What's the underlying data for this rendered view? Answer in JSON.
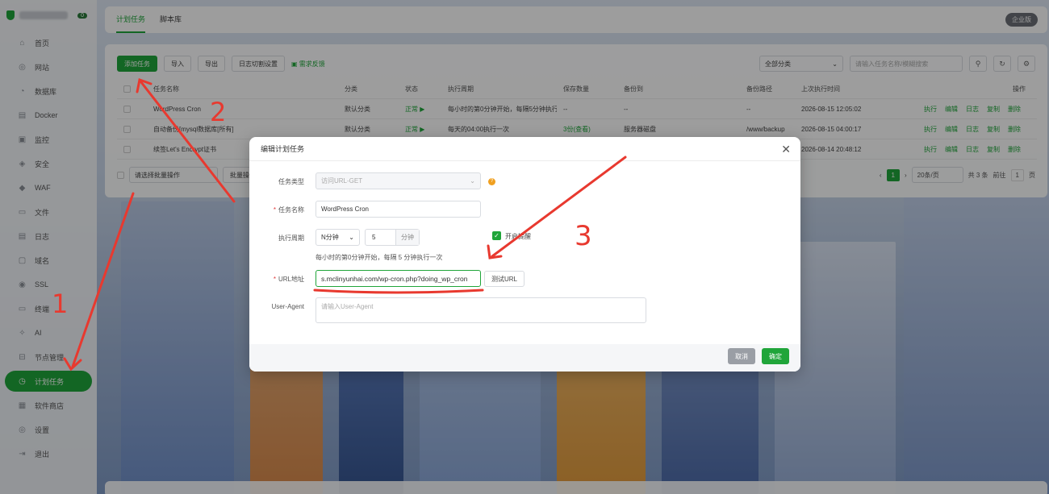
{
  "sidebar": {
    "badge": "0",
    "items": [
      {
        "label": "首页",
        "icon": "home-icon",
        "glyph": "⌂"
      },
      {
        "label": "网站",
        "icon": "globe-icon",
        "glyph": "◎"
      },
      {
        "label": "数据库",
        "icon": "database-icon",
        "glyph": "◔"
      },
      {
        "label": "Docker",
        "icon": "docker-icon",
        "glyph": "▤"
      },
      {
        "label": "监控",
        "icon": "monitor-icon",
        "glyph": "▣"
      },
      {
        "label": "安全",
        "icon": "shield-icon",
        "glyph": "◈"
      },
      {
        "label": "WAF",
        "icon": "firewall-icon",
        "glyph": "◆"
      },
      {
        "label": "文件",
        "icon": "folder-icon",
        "glyph": "▭"
      },
      {
        "label": "日志",
        "icon": "log-icon",
        "glyph": "▤"
      },
      {
        "label": "域名",
        "icon": "domain-icon",
        "glyph": "▢"
      },
      {
        "label": "SSL",
        "icon": "ssl-icon",
        "glyph": "◉"
      },
      {
        "label": "终端",
        "icon": "terminal-icon",
        "glyph": "▭"
      },
      {
        "label": "AI",
        "icon": "ai-icon",
        "glyph": "✧"
      },
      {
        "label": "节点管理",
        "icon": "node-icon",
        "glyph": "⊟"
      },
      {
        "label": "计划任务",
        "icon": "clock-icon",
        "glyph": "◷",
        "active": true
      },
      {
        "label": "软件商店",
        "icon": "store-icon",
        "glyph": "▦"
      },
      {
        "label": "设置",
        "icon": "settings-icon",
        "glyph": "◎"
      },
      {
        "label": "退出",
        "icon": "logout-icon",
        "glyph": "⇥"
      }
    ]
  },
  "topbar": {
    "tab1": "计划任务",
    "tab2": "脚本库",
    "edition": "企业版"
  },
  "toolbar": {
    "add": "添加任务",
    "import": "导入",
    "export": "导出",
    "log_cut": "日志切割设置",
    "feedback": "需求反馈",
    "category": "全部分类",
    "search_placeholder": "请输入任务名称/模糊搜索"
  },
  "table": {
    "headers": [
      "任务名称",
      "分类",
      "状态",
      "执行周期",
      "保存数量",
      "备份到",
      "备份路径",
      "上次执行时间",
      "操作"
    ],
    "rows": [
      {
        "name": "WordPress Cron",
        "category": "默认分类",
        "status": "正常 ▶",
        "period": "每小时的第0分钟开始，每隔5分钟执行",
        "keep": "--",
        "backup": "--",
        "path": "--",
        "last": "2026-08-15 12:05:02"
      },
      {
        "name": "自动备份[mysql数据库[所有]",
        "category": "默认分类",
        "status": "正常 ▶",
        "period": "每天的04:00执行一次",
        "keep": "3份(查看)",
        "backup": "服务器磁盘",
        "path": "/www/backup",
        "last": "2026-08-15 04:00:17"
      },
      {
        "name": "续签Let's Encrypt证书",
        "category": "默认分类",
        "status": "正常 ▶",
        "period": "",
        "keep": "",
        "backup": "",
        "path": "",
        "last": "2026-08-14 20:48:12"
      }
    ],
    "actions": [
      "执行",
      "编辑",
      "日志",
      "复制",
      "删除"
    ]
  },
  "batch": {
    "select": "请选择批量操作",
    "btn": "批量操作"
  },
  "pager": {
    "page": "1",
    "size": "20条/页",
    "total": "共 3 条",
    "goto": "前往",
    "goto_val": "1",
    "unit": "页"
  },
  "modal": {
    "title": "编辑计划任务",
    "task_type_label": "任务类型",
    "task_type_value": "访问URL-GET",
    "task_name_label": "任务名称",
    "task_name_value": "WordPress Cron",
    "period_label": "执行周期",
    "period_unit": "N分钟",
    "period_value": "5",
    "period_suffix": "分钟",
    "reminder": "开启提醒",
    "period_hint": "每小时的第0分钟开始，每隔 5 分钟执行一次",
    "url_label": "URL地址",
    "url_value": "s.mclinyunhai.com/wp-cron.php?doing_wp_cron",
    "test_url": "测试URL",
    "ua_label": "User-Agent",
    "ua_placeholder": "请输入User-Agent",
    "cancel": "取消",
    "confirm": "确定"
  },
  "annotations": {
    "n1": "1",
    "n2": "2",
    "n3": "3",
    "color": "#e8392f"
  }
}
